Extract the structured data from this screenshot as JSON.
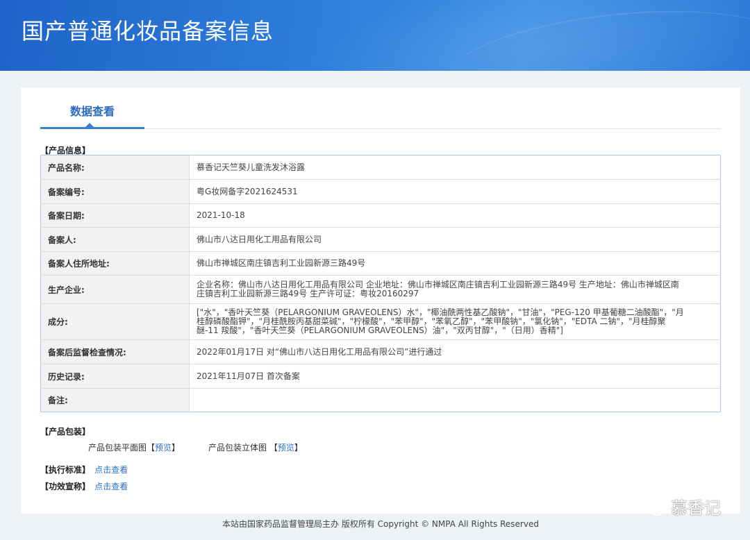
{
  "header": {
    "title": "国产普通化妆品备案信息"
  },
  "tab": {
    "label": "数据查看"
  },
  "product_info": {
    "section_title": "【产品信息】",
    "rows": [
      {
        "label": "产品名称:",
        "value": "慕香记天竺葵儿童洗发沐浴露"
      },
      {
        "label": "备案编号:",
        "value": "粤G妆网备字2021624531"
      },
      {
        "label": "备案日期:",
        "value": "2021-10-18"
      },
      {
        "label": "备案人:",
        "value": "佛山市八达日用化工用品有限公司"
      },
      {
        "label": "备案人住所地址:",
        "value": "佛山市禅城区南庄镇吉利工业园新源三路49号"
      },
      {
        "label": "生产企业:",
        "value": "企业名称：佛山市八达日用化工用品有限公司 企业地址：佛山市禅城区南庄镇吉利工业园新源三路49号 生产地址：佛山市禅城区南庄镇吉利工业园新源三路49号 生产许可证：粤妆20160297"
      },
      {
        "label": "成分:",
        "value": "[\"水\"，\"香叶天竺葵（PELARGONIUM GRAVEOLENS）水\"，\"椰油酰两性基乙酸钠\"，\"甘油\"，\"PEG-120 甲基葡糖二油酸酯\"，\"月桂醇磷酸酯钾\"，\"月桂酰胺丙基甜菜碱\"，\"柠檬酸\"，\"苯甲醇\"，\"苯氧乙醇\"，\"苯甲酸钠\"，\"氯化钠\"，\"EDTA 二钠\"，\"月桂醇聚醚-11 羧酸\"，\"香叶天竺葵（PELARGONIUM GRAVEOLENS）油\"，\"双丙甘醇\"，\"（日用）香精\"]"
      },
      {
        "label": "备案后监督检查情况:",
        "value": "2022年01月17日 对“佛山市八达日用化工用品有限公司”进行通过"
      },
      {
        "label": "历史记录:",
        "value": "2021年11月07日 首次备案"
      },
      {
        "label": "备注:",
        "value": ""
      }
    ]
  },
  "packaging": {
    "section_title": "【产品包装】",
    "flat_label": "产品包装平面图",
    "solid_label": "产品包装立体图",
    "bracket_open": "【",
    "bracket_close": "】",
    "preview_link": "预览"
  },
  "standard": {
    "label": "【执行标准】",
    "link": "点击查看"
  },
  "efficacy": {
    "label": "【功效宣称】",
    "link": "点击查看"
  },
  "footer": {
    "text": "本站由国家药品监督管理局主办 版权所有 Copyright © NMPA All Rights Reserved"
  },
  "watermark": {
    "text": "慕香记"
  }
}
